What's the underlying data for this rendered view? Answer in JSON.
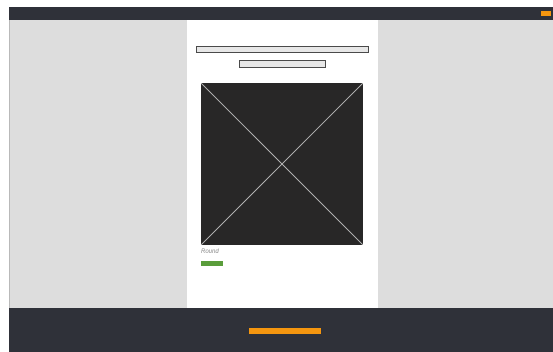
{
  "colors": {
    "chrome": "#2f3139",
    "accent": "#f5960f",
    "workspace": "#dddddd",
    "sheet": "#ffffff",
    "image": "#282727",
    "button": "#5a9d3b"
  },
  "page": {
    "caption": "Round"
  },
  "icons": {
    "image_placeholder": "image-placeholder-cross-icon"
  }
}
